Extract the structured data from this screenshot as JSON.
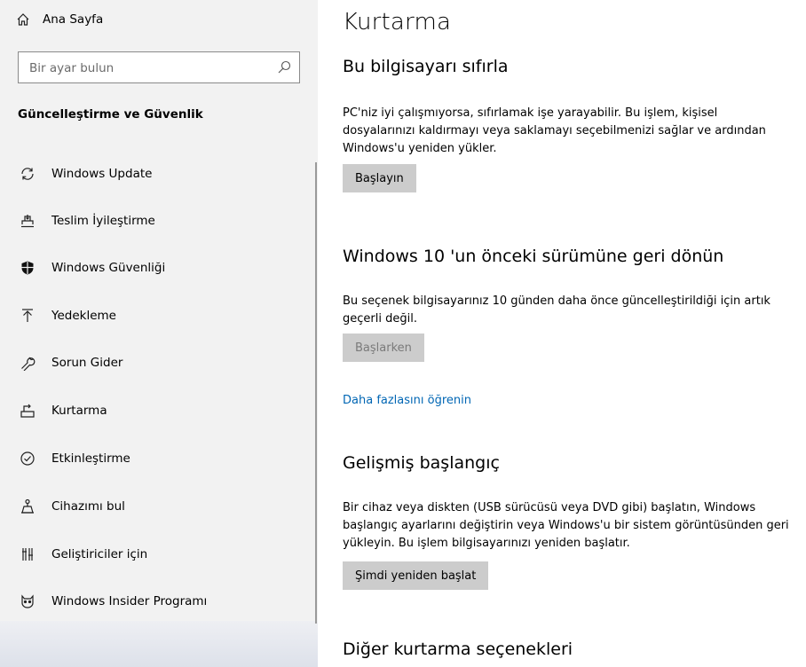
{
  "sidebar": {
    "home_label": "Ana Sayfa",
    "search_placeholder": "Bir ayar bulun",
    "section_title": "Güncelleştirme ve Güvenlik",
    "items": [
      {
        "label": "Windows Update",
        "icon": "sync-icon"
      },
      {
        "label": "Teslim İyileştirme",
        "icon": "delivery-icon"
      },
      {
        "label": "Windows Güvenliği",
        "icon": "shield-icon"
      },
      {
        "label": "Yedekleme",
        "icon": "backup-arrow-icon"
      },
      {
        "label": "Sorun Gider",
        "icon": "wrench-icon"
      },
      {
        "label": "Kurtarma",
        "icon": "recovery-icon"
      },
      {
        "label": "Etkinleştirme",
        "icon": "check-circle-icon"
      },
      {
        "label": "Cihazımı bul",
        "icon": "find-device-icon"
      },
      {
        "label": "Geliştiriciler için",
        "icon": "developer-icon"
      },
      {
        "label": "Windows Insider Programı",
        "icon": "insider-cat-icon"
      }
    ]
  },
  "main": {
    "title": "Kurtarma",
    "reset": {
      "heading": "Bu bilgisayarı sıfırla",
      "description": "PC'niz iyi çalışmıyorsa, sıfırlamak işe yarayabilir. Bu işlem, kişisel dosyalarınızı kaldırmayı veya saklamayı seçebilmenizi sağlar ve ardından Windows'u yeniden yükler.",
      "button": "Başlayın"
    },
    "rollback": {
      "heading": "Windows 10 'un önceki sürümüne geri dönün",
      "description": "Bu seçenek bilgisayarınız 10 günden daha önce güncelleştirildiği için artık geçerli değil.",
      "button": "Başlarken"
    },
    "learn_more": "Daha fazlasını öğrenin",
    "advanced": {
      "heading": "Gelişmiş başlangıç",
      "description": "Bir cihaz veya diskten (USB sürücüsü veya DVD gibi) başlatın, Windows başlangıç ayarlarını değiştirin veya Windows'u bir sistem görüntüsünden geri yükleyin. Bu işlem bilgisayarınızı yeniden başlatır.",
      "button": "Şimdi yeniden başlat"
    },
    "other": {
      "heading": "Diğer kurtarma seçenekleri"
    }
  }
}
